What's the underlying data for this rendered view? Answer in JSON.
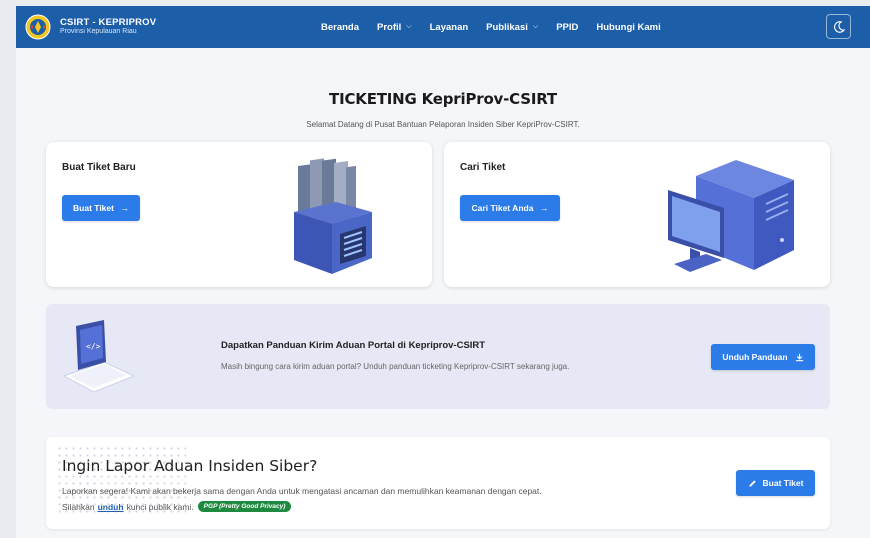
{
  "navbar": {
    "brand_title": "CSIRT - KEPRIPROV",
    "brand_subtitle": "Provinsi Kepulauan Riau",
    "logo_icon": "province-emblem-icon",
    "menu": [
      {
        "label": "Beranda",
        "dropdown": false
      },
      {
        "label": "Profil",
        "dropdown": true
      },
      {
        "label": "Layanan",
        "dropdown": false
      },
      {
        "label": "Publikasi",
        "dropdown": true
      },
      {
        "label": "PPID",
        "dropdown": false
      },
      {
        "label": "Hubungi Kami",
        "dropdown": false
      }
    ],
    "theme_toggle_icon": "moon-icon"
  },
  "hero": {
    "title": "TICKETING KepriProv-CSIRT",
    "subtitle": "Selamat Datang di Pusat Bantuan Pelaporan Insiden Siber KepriProv-CSIRT."
  },
  "cards": {
    "create": {
      "title": "Buat Tiket Baru",
      "button": "Buat Tiket",
      "button_icon": "arrow-right-icon",
      "illustration": "file-box-illustration"
    },
    "search": {
      "title": "Cari Tiket",
      "button": "Cari Tiket Anda",
      "button_icon": "arrow-right-icon",
      "illustration": "desktop-computer-illustration"
    }
  },
  "panduan": {
    "title": "Dapatkan Panduan Kirim Aduan Portal di Kepriprov-CSIRT",
    "description": "Masih bingung cara kirim aduan portal? Unduh panduan ticketing Kepriprov-CSIRT sekarang juga.",
    "button": "Unduh Panduan",
    "button_icon": "download-icon",
    "illustration": "laptop-code-illustration"
  },
  "lapor": {
    "title": "Ingin Lapor Aduan Insiden Siber?",
    "desc_line1": "Laporkan segera! Kami akan bekerja sama dengan Anda untuk mengatasi ancaman dan memulihkan keamanan dengan cepat.",
    "desc_line2_pre": "Silahkan",
    "desc_line2_link": "unduh",
    "desc_line2_post": "kunci publik kami.",
    "badge": "PGP (Pretty Good Privacy)",
    "button": "Buat Tiket",
    "button_icon": "pencil-icon"
  },
  "colors": {
    "navbar": "#1c5ea8",
    "button": "#2b7ce8",
    "badge": "#1d8a3f",
    "illustration": "#4a6cc9"
  }
}
